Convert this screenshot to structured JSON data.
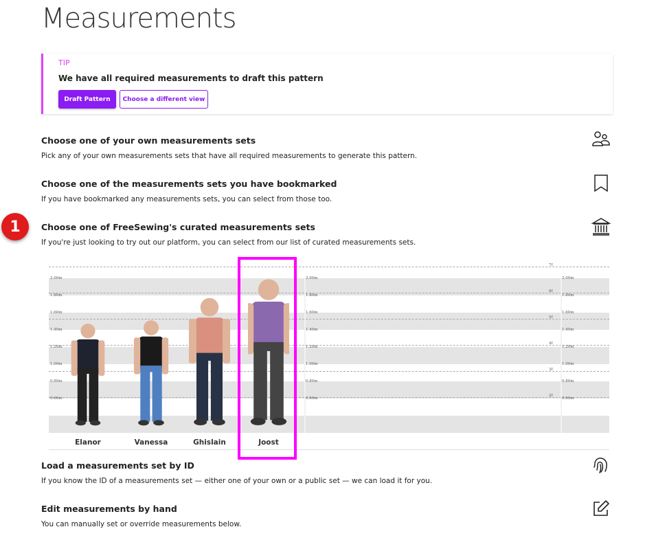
{
  "page": {
    "title": "Measurements"
  },
  "tip": {
    "label": "TIP",
    "text": "We have all required measurements to draft this pattern",
    "primary_button": "Draft Pattern",
    "secondary_button": "Choose a different view",
    "accent": "#e040fb",
    "button_color": "#8b1cf2"
  },
  "sections": [
    {
      "title": "Choose one of your own measurements sets",
      "description": "Pick any of your own measurements sets that have all required measurements to generate this pattern.",
      "icon": "users-icon"
    },
    {
      "title": "Choose one of the measurements sets you have bookmarked",
      "description": "If you have bookmarked any measurements sets, you can select from those too.",
      "icon": "bookmark-icon"
    },
    {
      "title": "Choose one of FreeSewing's curated measurements sets",
      "description": "If you're just looking to try out our platform, you can select from our list of curated measurements sets.",
      "icon": "bank-icon"
    },
    {
      "title": "Load a measurements set by ID",
      "description": "If you know the ID of a measurements set — either one of your own or a public set — we can load it for you.",
      "icon": "fingerprint-icon"
    },
    {
      "title": "Edit measurements by hand",
      "description": "You can manually set or override measurements below.",
      "icon": "edit-icon"
    }
  ],
  "annotation": {
    "number": "1",
    "color": "#e01b1b"
  },
  "curated": {
    "metric_labels": [
      "2.00m",
      "1.80m",
      "1.60m",
      "1.40m",
      "1.20m",
      "1.00m",
      "0.80m",
      "0.60m"
    ],
    "imperial_labels": [
      "7f",
      "6f",
      "5f",
      "4f",
      "3f",
      "2f"
    ],
    "sets": [
      {
        "name": "Elanor",
        "shirt": "#1f2330",
        "pants": "#222",
        "selected": false
      },
      {
        "name": "Vanessa",
        "shirt": "#1a1a1a",
        "pants": "#4f7fc0",
        "selected": false
      },
      {
        "name": "Ghislain",
        "shirt": "#d9907e",
        "pants": "#273247",
        "selected": false
      },
      {
        "name": "Joost",
        "shirt": "#8a69ae",
        "pants": "#444",
        "selected": true
      }
    ],
    "highlight_color": "#ff00ff"
  }
}
